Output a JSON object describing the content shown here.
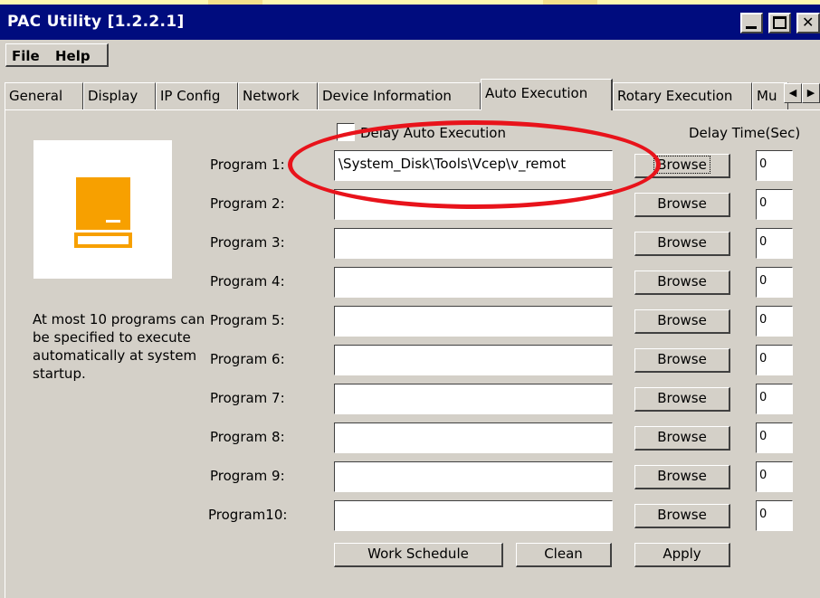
{
  "window": {
    "title": "PAC Utility  [1.2.2.1]"
  },
  "menu": {
    "file": "File",
    "help": "Help"
  },
  "tabs": [
    {
      "label": "General"
    },
    {
      "label": "Display"
    },
    {
      "label": "IP Config"
    },
    {
      "label": "Network"
    },
    {
      "label": "Device Information"
    },
    {
      "label": "Auto Execution",
      "active": true
    },
    {
      "label": "Rotary Execution"
    },
    {
      "label": "Mu"
    }
  ],
  "auto_execution": {
    "delay_checkbox_label": "Delay Auto Execution",
    "delay_checked": false,
    "delay_time_header": "Delay Time(Sec)",
    "note": "At most 10 programs can be specified to execute automatically at system startup.",
    "browse_label": "Browse",
    "programs": [
      {
        "label": "Program 1:",
        "path": "\\System_Disk\\Tools\\Vcep\\v_remot",
        "delay": "0"
      },
      {
        "label": "Program 2:",
        "path": "",
        "delay": "0"
      },
      {
        "label": "Program 3:",
        "path": "",
        "delay": "0"
      },
      {
        "label": "Program 4:",
        "path": "",
        "delay": "0"
      },
      {
        "label": "Program 5:",
        "path": "",
        "delay": "0"
      },
      {
        "label": "Program 6:",
        "path": "",
        "delay": "0"
      },
      {
        "label": "Program 7:",
        "path": "",
        "delay": "0"
      },
      {
        "label": "Program 8:",
        "path": "",
        "delay": "0"
      },
      {
        "label": "Program 9:",
        "path": "",
        "delay": "0"
      },
      {
        "label": "Program10:",
        "path": "",
        "delay": "0"
      }
    ],
    "buttons": {
      "work_schedule": "Work Schedule",
      "clean": "Clean",
      "apply": "Apply"
    }
  },
  "colors": {
    "highlight_ellipse": "#e8131b",
    "icon_orange": "#f7a000",
    "titlebar": "#000c7e"
  },
  "icons": {
    "app_icon": "computer-icon"
  }
}
